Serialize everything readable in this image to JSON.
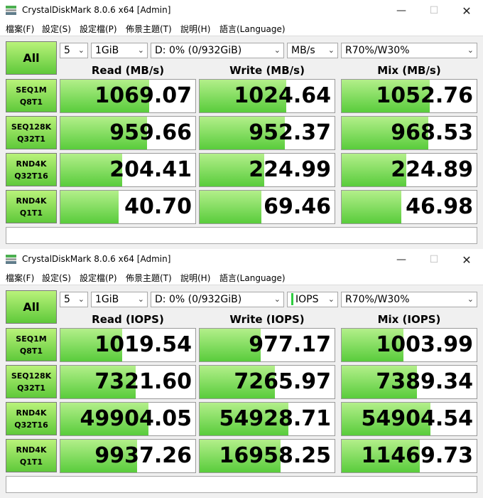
{
  "windows": [
    {
      "title": "CrystalDiskMark 8.0.6 x64 [Admin]",
      "menu": [
        "檔案(F)",
        "設定(S)",
        "設定檔(P)",
        "佈景主題(T)",
        "說明(H)",
        "語言(Language)"
      ],
      "all_label": "All",
      "count": "5",
      "size": "1GiB",
      "drive": "D: 0% (0/932GiB)",
      "unit": "MB/s",
      "profile": "R70%/W30%",
      "headers": [
        "Read (MB/s)",
        "Write (MB/s)",
        "Mix (MB/s)"
      ],
      "rows": [
        {
          "label1": "SEQ1M",
          "label2": "Q8T1",
          "values": [
            "1069.07",
            "1024.64",
            "1052.76"
          ],
          "fill": [
            0.66,
            0.64,
            0.65
          ]
        },
        {
          "label1": "SEQ128K",
          "label2": "Q32T1",
          "values": [
            "959.66",
            "952.37",
            "968.53"
          ],
          "fill": [
            0.64,
            0.63,
            0.64
          ]
        },
        {
          "label1": "RND4K",
          "label2": "Q32T16",
          "values": [
            "204.41",
            "224.99",
            "224.89"
          ],
          "fill": [
            0.46,
            0.48,
            0.48
          ]
        },
        {
          "label1": "RND4K",
          "label2": "Q1T1",
          "values": [
            "40.70",
            "69.46",
            "46.98"
          ],
          "fill": [
            0.43,
            0.46,
            0.44
          ]
        }
      ],
      "comment": ""
    },
    {
      "title": "CrystalDiskMark 8.0.6 x64 [Admin]",
      "menu": [
        "檔案(F)",
        "設定(S)",
        "設定檔(P)",
        "佈景主題(T)",
        "說明(H)",
        "語言(Language)"
      ],
      "all_label": "All",
      "count": "5",
      "size": "1GiB",
      "drive": "D: 0% (0/932GiB)",
      "unit": "IOPS",
      "profile": "R70%/W30%",
      "headers": [
        "Read (IOPS)",
        "Write (IOPS)",
        "Mix (IOPS)"
      ],
      "rows": [
        {
          "label1": "SEQ1M",
          "label2": "Q8T1",
          "values": [
            "1019.54",
            "977.17",
            "1003.99"
          ],
          "fill": [
            0.46,
            0.45,
            0.46
          ]
        },
        {
          "label1": "SEQ128K",
          "label2": "Q32T1",
          "values": [
            "7321.60",
            "7265.97",
            "7389.34"
          ],
          "fill": [
            0.56,
            0.56,
            0.56
          ]
        },
        {
          "label1": "RND4K",
          "label2": "Q32T16",
          "values": [
            "49904.05",
            "54928.71",
            "54904.54"
          ],
          "fill": [
            0.65,
            0.66,
            0.66
          ]
        },
        {
          "label1": "RND4K",
          "label2": "Q1T1",
          "values": [
            "9937.26",
            "16958.25",
            "11469.73"
          ],
          "fill": [
            0.57,
            0.6,
            0.58
          ]
        }
      ],
      "comment": ""
    }
  ]
}
